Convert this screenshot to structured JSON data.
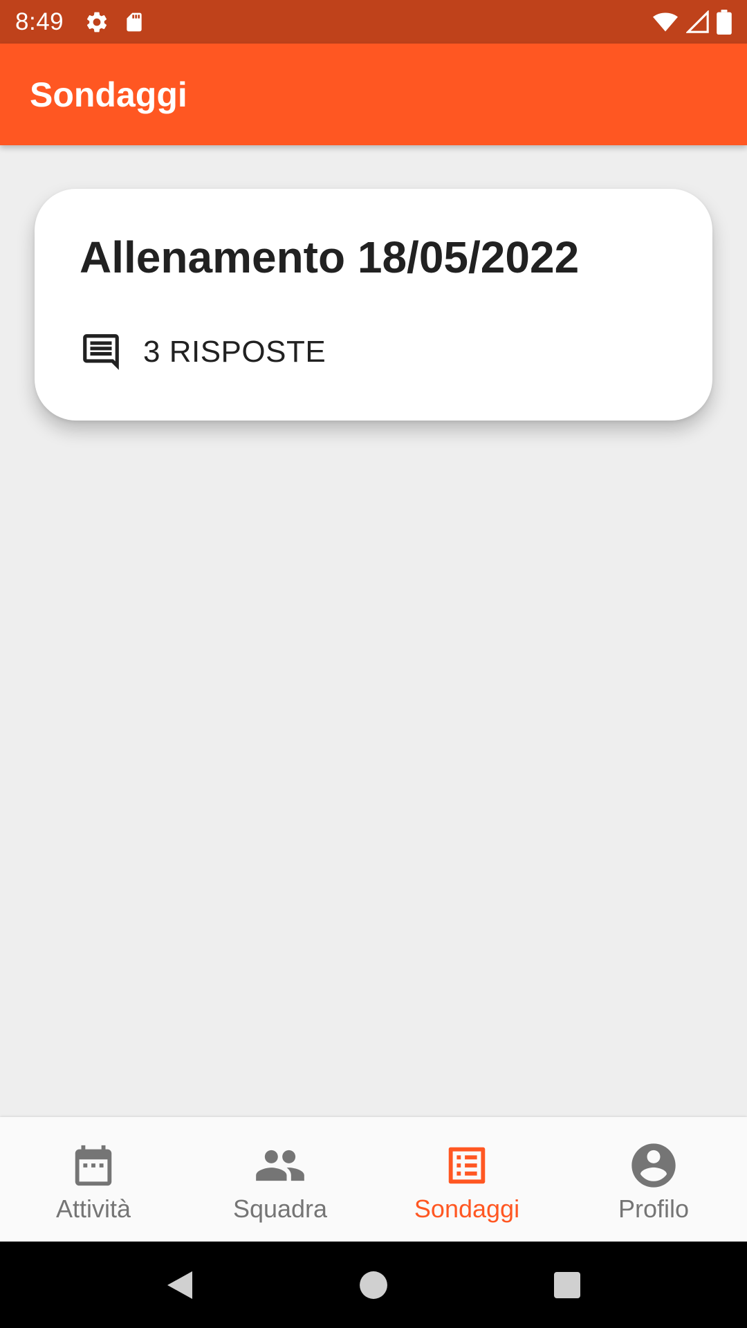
{
  "status_bar": {
    "time": "8:49",
    "icons_left": [
      "settings-icon",
      "sd-card-icon"
    ],
    "icons_right": [
      "wifi-icon",
      "signal-icon",
      "battery-icon"
    ],
    "background": "#BF421B"
  },
  "app_bar": {
    "title": "Sondaggi",
    "background": "#FF5722"
  },
  "polls": [
    {
      "title": "Allenamento 18/05/2022",
      "responses_icon": "comment-icon",
      "responses_label": "3 RISPOSTE"
    }
  ],
  "bottom_nav": {
    "active_color": "#FF5722",
    "inactive_color": "#757575",
    "items": [
      {
        "label": "Attività",
        "icon": "calendar-icon",
        "active": false
      },
      {
        "label": "Squadra",
        "icon": "group-icon",
        "active": false
      },
      {
        "label": "Sondaggi",
        "icon": "poll-list-icon",
        "active": true
      },
      {
        "label": "Profilo",
        "icon": "account-circle-icon",
        "active": false
      }
    ]
  },
  "system_nav": {
    "buttons": [
      "back-icon",
      "home-icon",
      "recents-icon"
    ]
  }
}
